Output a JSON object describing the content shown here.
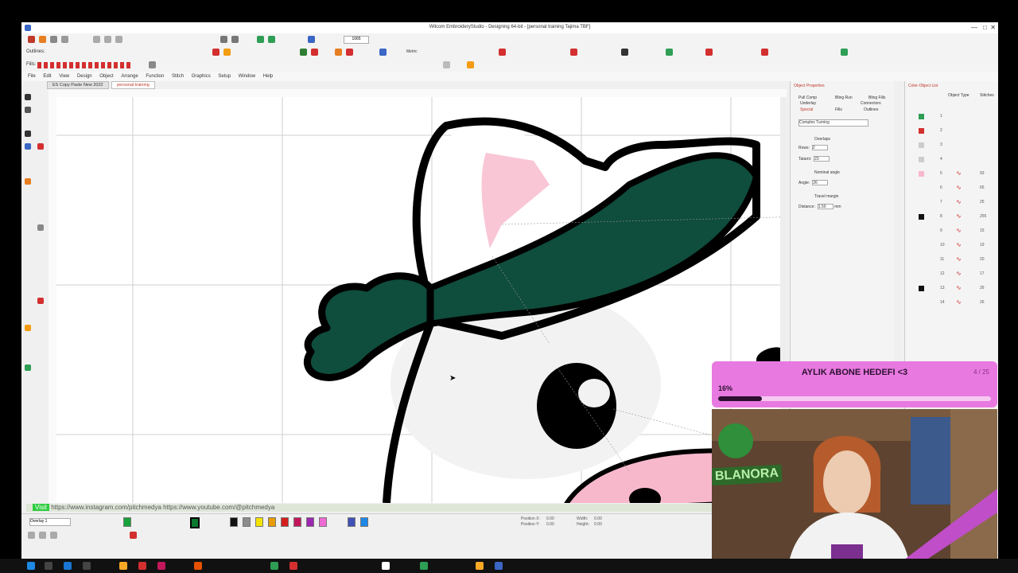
{
  "window": {
    "title": "Wilcom EmbroideryStudio - Designing 64-bit - [personal training    Tajima TBF]"
  },
  "toolbar": {
    "outlines_label": "Outlines:",
    "fills_label": "Fills:",
    "zoom_value": "1065",
    "metric_label": "Metric"
  },
  "menu": {
    "items": [
      "File",
      "Edit",
      "View",
      "Design",
      "Object",
      "Arrange",
      "Function",
      "Stitch",
      "Graphics",
      "Setup",
      "Window",
      "Help"
    ]
  },
  "doc_tabs": [
    {
      "label": "ES Copy Paste New 2022"
    },
    {
      "label": "personal training"
    }
  ],
  "properties": {
    "title": "Object Properties",
    "tabs": [
      "Pull Comp",
      "Bling Run",
      "Bling Fills",
      "Underlay",
      "Connectors",
      "Special",
      "Fills",
      "Outlines"
    ],
    "fill_type": "Complex Turning",
    "overlaps_label": "Overlaps",
    "rows_label": "Rows:",
    "rows_value": "2",
    "tatami_label": "Tatami:",
    "tatami_value": "23",
    "nominal_label": "Nominal angle",
    "angle_label": "Angle:",
    "angle_value": "26",
    "travel_label": "Travel margin",
    "distance_label": "Distance:",
    "distance_value": "1.50",
    "distance_unit": "mm"
  },
  "object_list": {
    "title": "Color-Object List",
    "headers": [
      "Object Type",
      "Stitches"
    ],
    "rows": [
      {
        "num": "1",
        "count": ""
      },
      {
        "num": "2",
        "count": ""
      },
      {
        "num": "3",
        "count": ""
      },
      {
        "num": "4",
        "count": ""
      },
      {
        "num": "5",
        "count": "93"
      },
      {
        "num": "6",
        "count": "65"
      },
      {
        "num": "7",
        "count": "25"
      },
      {
        "num": "8",
        "count": "255"
      },
      {
        "num": "9",
        "count": "15"
      },
      {
        "num": "10",
        "count": "19"
      },
      {
        "num": "11",
        "count": "20"
      },
      {
        "num": "12",
        "count": "17"
      },
      {
        "num": "13",
        "count": "26"
      },
      {
        "num": "14",
        "count": "26"
      }
    ]
  },
  "url_bar": {
    "badge": "Visit",
    "text": "https://www.instagram.com/pitchmedya https://www.youtube.com/@pitchmedya"
  },
  "color_bar": {
    "design_label": "Overlay 1",
    "chips": [
      "#18a23a",
      "#0b7a2f",
      "#111111",
      "#8c8c8c",
      "#f5e400",
      "#e89c00",
      "#d31f1f",
      "#c2185b",
      "#9c27b0",
      "#f06ad4",
      "#3f51b5",
      "#1e88e5"
    ]
  },
  "status": {
    "position_x_label": "Position X:",
    "position_y_label": "Position Y:",
    "width_label": "Width:",
    "height_label": "Height:",
    "value": "0.00"
  },
  "stream_goal": {
    "title": "AYLIK ABONE HEDEFI <3",
    "count": "4 / 25",
    "percent_text": "16%",
    "progress": 0.16
  },
  "webcam": {
    "sign_text": "BLANORA"
  },
  "colors": {
    "hat_green": "#0f4d3c",
    "outline": "#000000",
    "pink_stitch": "#f8b8cc",
    "accent_red": "#d32f2f"
  }
}
